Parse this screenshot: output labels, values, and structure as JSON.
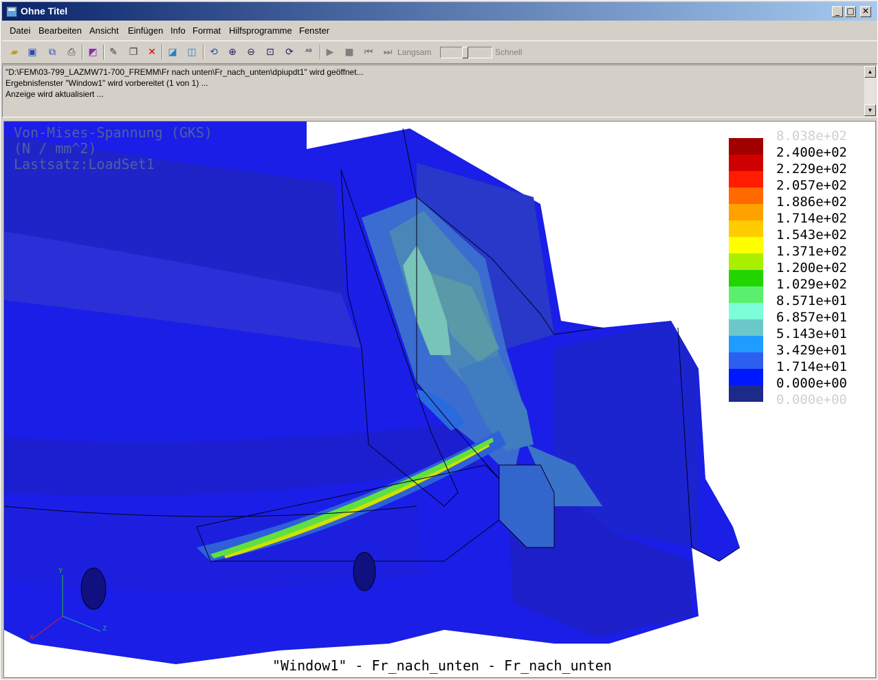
{
  "window": {
    "title": "Ohne Titel",
    "minimize": "_",
    "maximize": "□",
    "close": "✕"
  },
  "menu": {
    "items": [
      "Datei",
      "Bearbeiten",
      "Ansicht",
      "Einfügen",
      "Info",
      "Format",
      "Hilfsprogramme",
      "Fenster"
    ]
  },
  "toolbar": {
    "buttons": [
      "open-icon",
      "save-icon",
      "copy-file-icon",
      "print-icon",
      "result-icon",
      "edit-icon",
      "copy-icon",
      "delete-icon",
      "view-icon",
      "view-edit-icon",
      "refresh-icon",
      "zoom-in-icon",
      "zoom-out-icon",
      "zoom-fit-icon",
      "spin-icon",
      "label-icon",
      "play-icon",
      "stop-icon",
      "first-frame-icon",
      "last-frame-icon"
    ],
    "speed_slow": "Langsam",
    "speed_fast": "Schnell",
    "speed_level": 0.48
  },
  "messages": [
    "\"D:\\FEM\\03-799_LAZMW71-700_FREMM\\Fr nach unten\\Fr_nach_unten\\dpiupdt1\" wird geöffnet...",
    "Ergebnisfenster \"Window1\" wird vorbereitet (1 von 1) ...",
    "Anzeige wird aktualisiert ..."
  ],
  "viewport": {
    "header_lines": [
      "Von-Mises-Spannung (GKS)",
      "(N / mm^2)",
      "Lastsatz:LoadSet1"
    ],
    "footer": "\"Window1\" - Fr_nach_unten - Fr_nach_unten",
    "axis": {
      "x": "X",
      "y": "Y",
      "z": "Z"
    }
  },
  "legend": {
    "max_label": "8.038e+02",
    "min_label": "0.000e+00",
    "entries": [
      {
        "label": "2.400e+02",
        "color": "#a00000"
      },
      {
        "label": "2.229e+02",
        "color": "#d00000"
      },
      {
        "label": "2.057e+02",
        "color": "#ff1c00"
      },
      {
        "label": "1.886e+02",
        "color": "#ff6a00"
      },
      {
        "label": "1.714e+02",
        "color": "#ffa200"
      },
      {
        "label": "1.543e+02",
        "color": "#ffcc00"
      },
      {
        "label": "1.371e+02",
        "color": "#ffff00"
      },
      {
        "label": "1.200e+02",
        "color": "#a8f000"
      },
      {
        "label": "1.029e+02",
        "color": "#22d400"
      },
      {
        "label": "8.571e+01",
        "color": "#5af06e"
      },
      {
        "label": "6.857e+01",
        "color": "#7cffd8"
      },
      {
        "label": "5.143e+01",
        "color": "#6ac8c8"
      },
      {
        "label": "3.429e+01",
        "color": "#1e9cff"
      },
      {
        "label": "1.714e+01",
        "color": "#2c5ff0"
      },
      {
        "label": "0.000e+00",
        "color": "#0018ff"
      },
      {
        "label": "",
        "color": "#1c2a8a"
      }
    ]
  }
}
